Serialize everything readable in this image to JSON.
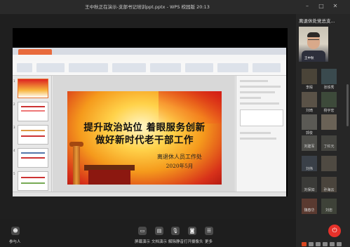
{
  "window": {
    "title": "王中秋正在演示-支部书记培训ppt.pptx - WPS 校园版 20:13"
  },
  "slide": {
    "title_line1": "提升政治站位 着眼服务创新",
    "title_line2": "做好新时代老干部工作",
    "organization": "离退休人员工作处",
    "date": "2020年5月"
  },
  "sidebar": {
    "panel_title": "离退休处党总支...",
    "participants": [
      {
        "name": "王中秋"
      },
      {
        "name": "李殿"
      },
      {
        "name": "张铁秀"
      },
      {
        "name": "刘琦"
      },
      {
        "name": "杨宇宏"
      },
      {
        "name": "郭俊"
      },
      {
        "name": ""
      },
      {
        "name": "刘建军"
      },
      {
        "name": "丁红元"
      },
      {
        "name": "刘伟"
      },
      {
        "name": ""
      },
      {
        "name": "刘保如"
      },
      {
        "name": "孙海云"
      },
      {
        "name": "魏春华"
      },
      {
        "name": "刘忠"
      }
    ]
  },
  "controls": {
    "participants_label": "参与人",
    "screen_share_label": "屏幕演示",
    "doc_share_label": "文档演示",
    "mute_label": "解除静音",
    "camera_label": "打开摄像头",
    "more_label": "更多"
  },
  "colors": {
    "leave_button": "#e6312a",
    "wps_tab": "#e86a3c"
  }
}
